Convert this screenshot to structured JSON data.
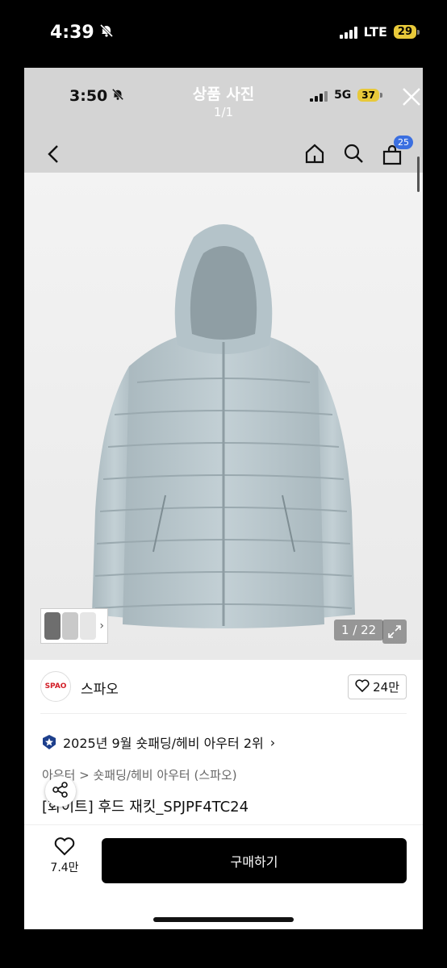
{
  "outer_status": {
    "time": "4:39",
    "network": "LTE",
    "battery": "29"
  },
  "inner_status": {
    "time": "3:50",
    "network": "5G",
    "battery": "37"
  },
  "photo_viewer": {
    "title": "상품 사진",
    "counter": "1/1"
  },
  "header": {
    "cart_count": "25"
  },
  "gallery": {
    "counter": "1 / 22"
  },
  "brand": {
    "logo_text": "SPAO",
    "name": "스파오",
    "likes": "24만"
  },
  "ranking": {
    "text": "2025년 9월 숏패딩/헤비 아우터 2위"
  },
  "category": {
    "text": "아우터 > 숏패딩/헤비 아우터 (스파오)"
  },
  "product": {
    "title": "[화이트] 후드 재킷_SPJPF4TC24"
  },
  "bottom_bar": {
    "wish_count": "7.4만",
    "buy_label": "구매하기"
  },
  "colors": {
    "jacket": "#b8c6cc",
    "buy_button": "#000000",
    "badge": "#3b6fe0",
    "battery": "#e8c93a",
    "brand_red": "#d21e27"
  }
}
